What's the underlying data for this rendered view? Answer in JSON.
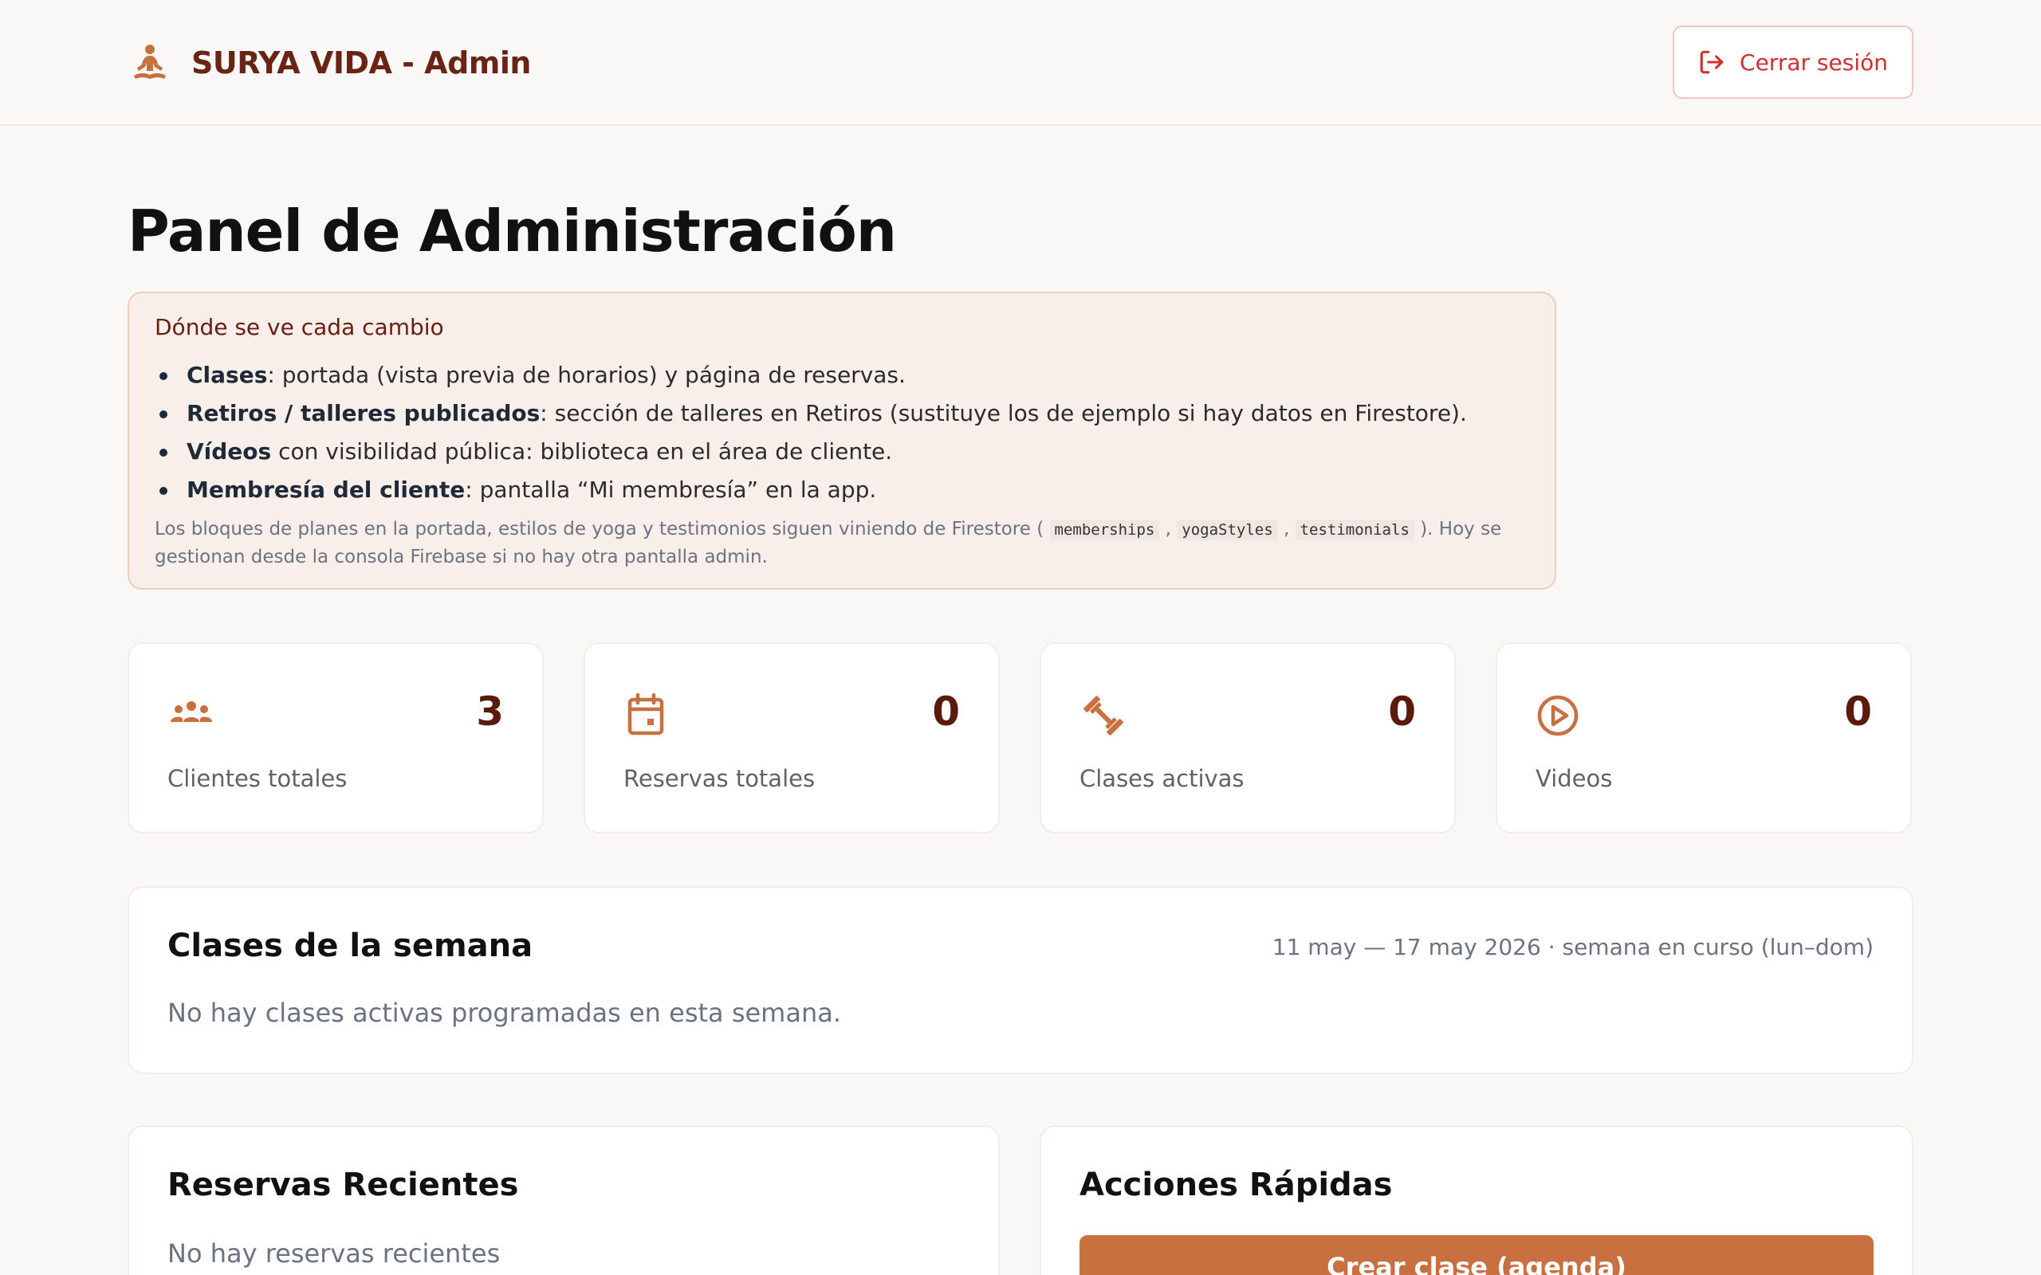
{
  "header": {
    "brand": "SURYA VIDA - Admin",
    "brand_icon": "meditation-icon",
    "logout_label": "Cerrar sesión",
    "logout_icon": "logout-icon"
  },
  "page_title": "Panel de Administración",
  "info": {
    "title": "Dónde se ve cada cambio",
    "items": [
      {
        "bold": "Clases",
        "text": ": portada (vista previa de horarios) y página de reservas."
      },
      {
        "bold": "Retiros / talleres publicados",
        "text": ": sección de talleres en Retiros (sustituye los de ejemplo si hay datos en Firestore)."
      },
      {
        "bold": "Vídeos",
        "text": " con visibilidad pública: biblioteca en el área de cliente."
      },
      {
        "bold": "Membresía del cliente",
        "text": ": pantalla “Mi membresía” en la app."
      }
    ],
    "note_prefix": "Los bloques de planes en la portada, estilos de yoga y testimonios siguen viniendo de Firestore (",
    "note_codes": [
      "memberships",
      "yogaStyles",
      "testimonials"
    ],
    "note_suffix": "). Hoy se gestionan desde la consola Firebase si no hay otra pantalla admin."
  },
  "stats": [
    {
      "label": "Clientes totales",
      "value": "3",
      "icon": "users-icon"
    },
    {
      "label": "Reservas totales",
      "value": "0",
      "icon": "calendar-icon"
    },
    {
      "label": "Clases activas",
      "value": "0",
      "icon": "dumbbell-icon"
    },
    {
      "label": "Videos",
      "value": "0",
      "icon": "play-icon"
    }
  ],
  "week": {
    "title": "Clases de la semana",
    "range": "11 may — 17 may 2026 · semana en curso (lun–dom)",
    "empty": "No hay clases activas programadas en esta semana."
  },
  "recent": {
    "title": "Reservas Recientes",
    "empty": "No hay reservas recientes"
  },
  "quick": {
    "title": "Acciones Rápidas",
    "create_label": "Crear clase (agenda)"
  },
  "colors": {
    "accent": "#c8703f",
    "brand_text": "#6b2414",
    "logout": "#d22f2f",
    "background": "#faf8f6"
  }
}
